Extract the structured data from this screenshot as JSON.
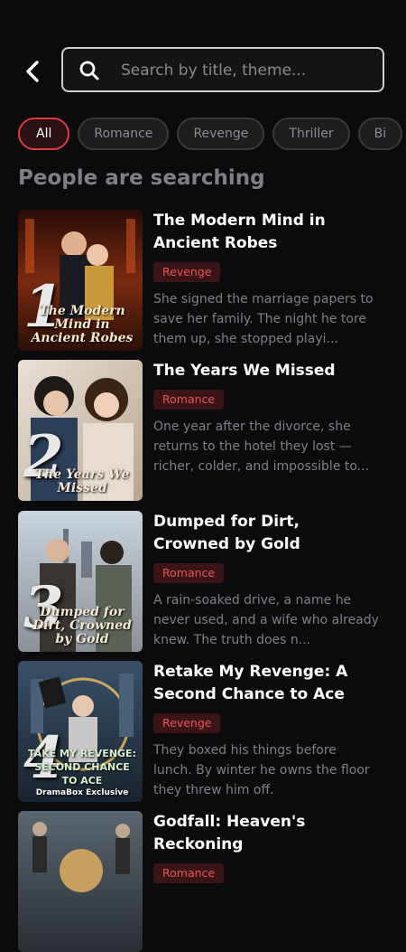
{
  "search": {
    "placeholder": "Search by title, theme..."
  },
  "chips": [
    "All",
    "Romance",
    "Revenge",
    "Thriller",
    "Bi"
  ],
  "section_title": "People are searching",
  "items": [
    {
      "rank": "1",
      "title": "The Modern Mind in Ancient Robes",
      "tag": "Revenge",
      "desc": "She signed the marriage papers to save her family. The night he tore them up, she stopped playi...",
      "cover_text": "The Modern Mind in Ancient Robes"
    },
    {
      "rank": "2",
      "title": "The Years We Missed",
      "tag": "Romance",
      "desc": "One year after the divorce, she returns to the hotel they lost — richer, colder, and impossible to...",
      "cover_text": "The Years We Missed"
    },
    {
      "rank": "3",
      "title": "Dumped for Dirt, Crowned by Gold",
      "tag": "Romance",
      "desc": "A rain-soaked drive, a name he never used, and a wife who already knew. The truth does n...",
      "cover_text": "Dumped for Dirt, Crowned by Gold"
    },
    {
      "rank": "4",
      "title": "Retake My Revenge: A Second Chance to Ace",
      "tag": "Revenge",
      "desc": "They boxed his things before lunch. By winter he owns the floor they threw him off.",
      "cover_text": "TAKE MY REVENGE: SECOND CHANCE TO ACE",
      "cover_sub": "DramaBox Exclusive"
    },
    {
      "title": "Godfall: Heaven's Reckoning",
      "tag": "Romance"
    }
  ],
  "colors": {
    "accent": "#e0393f",
    "background": "#0b0b0d",
    "tag_bg": "#3a1518",
    "tag_text": "#e8535a"
  }
}
